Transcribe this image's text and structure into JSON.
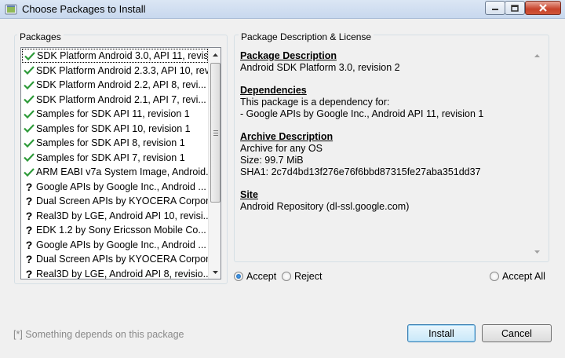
{
  "window": {
    "title": "Choose Packages to Install",
    "icon": "android-sdk-icon"
  },
  "packages": {
    "label": "Packages",
    "items": [
      {
        "status": "check",
        "label": "SDK Platform Android 3.0, API 11, revis...",
        "selected": true
      },
      {
        "status": "check",
        "label": "SDK Platform Android 2.3.3, API 10, rev..."
      },
      {
        "status": "check",
        "label": "SDK Platform Android 2.2, API 8, revi..."
      },
      {
        "status": "check",
        "label": "SDK Platform Android 2.1, API 7, revi..."
      },
      {
        "status": "check",
        "label": "Samples for SDK API 11, revision 1"
      },
      {
        "status": "check",
        "label": "Samples for SDK API 10, revision 1"
      },
      {
        "status": "check",
        "label": "Samples for SDK API 8, revision 1"
      },
      {
        "status": "check",
        "label": "Samples for SDK API 7, revision 1"
      },
      {
        "status": "check",
        "label": "ARM EABI v7a System Image, Android..."
      },
      {
        "status": "question",
        "label": "Google APIs by Google Inc., Android ..."
      },
      {
        "status": "question",
        "label": "Dual Screen APIs by KYOCERA Corpor..."
      },
      {
        "status": "question",
        "label": "Real3D by LGE, Android API 10, revisi..."
      },
      {
        "status": "question",
        "label": "EDK 1.2 by Sony Ericsson Mobile Co..."
      },
      {
        "status": "question",
        "label": "Google APIs by Google Inc., Android ..."
      },
      {
        "status": "question",
        "label": "Dual Screen APIs by KYOCERA Corpor..."
      },
      {
        "status": "question",
        "label": "Real3D by LGE, Android API 8, revisio..."
      }
    ]
  },
  "description": {
    "label": "Package Description & License",
    "package_heading": "Package Description",
    "package_text": "Android SDK Platform 3.0, revision 2",
    "dependencies_heading": "Dependencies",
    "dependencies_line1": "This package is a dependency for:",
    "dependencies_line2": "- Google APIs by Google Inc., Android API 11, revision 1",
    "archive_heading": "Archive Description",
    "archive_line1": "Archive for any OS",
    "archive_line2": "Size: 99.7 MiB",
    "archive_line3": "SHA1: 2c7d4bd13f276e76f6bbd87315fe27aba351dd37",
    "site_heading": "Site",
    "site_text": "Android Repository (dl-ssl.google.com)"
  },
  "license": {
    "accept_label": "Accept",
    "reject_label": "Reject",
    "accept_all_label": "Accept All",
    "selected": "accept"
  },
  "footer": {
    "hint": "[*] Something depends on this package",
    "install_label": "Install",
    "cancel_label": "Cancel"
  },
  "colors": {
    "check": "#2e9b3a",
    "titlebar": "#dbe6f4",
    "close_button": "#c7432b"
  }
}
